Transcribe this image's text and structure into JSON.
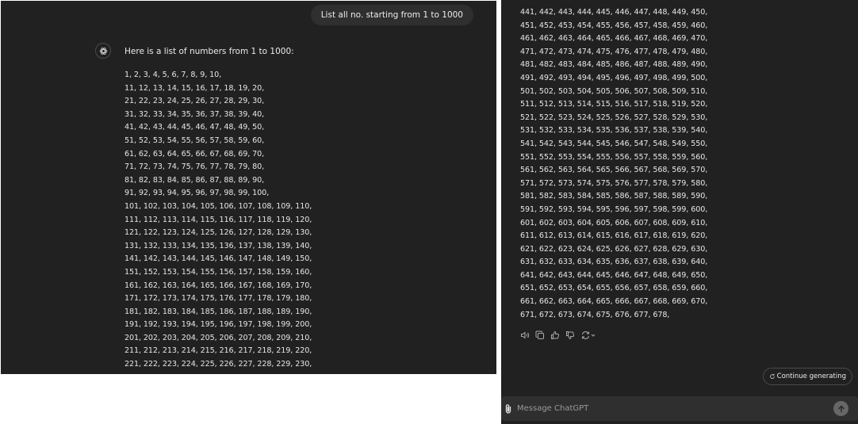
{
  "left": {
    "user_message": "List all no. starting from 1 to 1000",
    "intro": "Here is a list of numbers from 1 to 1000:",
    "lines": [
      "1, 2, 3, 4, 5, 6, 7, 8, 9, 10,",
      "11, 12, 13, 14, 15, 16, 17, 18, 19, 20,",
      "21, 22, 23, 24, 25, 26, 27, 28, 29, 30,",
      "31, 32, 33, 34, 35, 36, 37, 38, 39, 40,",
      "41, 42, 43, 44, 45, 46, 47, 48, 49, 50,",
      "51, 52, 53, 54, 55, 56, 57, 58, 59, 60,",
      "61, 62, 63, 64, 65, 66, 67, 68, 69, 70,",
      "71, 72, 73, 74, 75, 76, 77, 78, 79, 80,",
      "81, 82, 83, 84, 85, 86, 87, 88, 89, 90,",
      "91, 92, 93, 94, 95, 96, 97, 98, 99, 100,",
      "101, 102, 103, 104, 105, 106, 107, 108, 109, 110,",
      "111, 112, 113, 114, 115, 116, 117, 118, 119, 120,",
      "121, 122, 123, 124, 125, 126, 127, 128, 129, 130,",
      "131, 132, 133, 134, 135, 136, 137, 138, 139, 140,",
      "141, 142, 143, 144, 145, 146, 147, 148, 149, 150,",
      "151, 152, 153, 154, 155, 156, 157, 158, 159, 160,",
      "161, 162, 163, 164, 165, 166, 167, 168, 169, 170,",
      "171, 172, 173, 174, 175, 176, 177, 178, 179, 180,",
      "181, 182, 183, 184, 185, 186, 187, 188, 189, 190,",
      "191, 192, 193, 194, 195, 196, 197, 198, 199, 200,",
      "201, 202, 203, 204, 205, 206, 207, 208, 209, 210,",
      "211, 212, 213, 214, 215, 216, 217, 218, 219, 220,",
      "221, 222, 223, 224, 225, 226, 227, 228, 229, 230,"
    ]
  },
  "right": {
    "lines": [
      "441, 442, 443, 444, 445, 446, 447, 448, 449, 450,",
      "451, 452, 453, 454, 455, 456, 457, 458, 459, 460,",
      "461, 462, 463, 464, 465, 466, 467, 468, 469, 470,",
      "471, 472, 473, 474, 475, 476, 477, 478, 479, 480,",
      "481, 482, 483, 484, 485, 486, 487, 488, 489, 490,",
      "491, 492, 493, 494, 495, 496, 497, 498, 499, 500,",
      "501, 502, 503, 504, 505, 506, 507, 508, 509, 510,",
      "511, 512, 513, 514, 515, 516, 517, 518, 519, 520,",
      "521, 522, 523, 524, 525, 526, 527, 528, 529, 530,",
      "531, 532, 533, 534, 535, 536, 537, 538, 539, 540,",
      "541, 542, 543, 544, 545, 546, 547, 548, 549, 550,",
      "551, 552, 553, 554, 555, 556, 557, 558, 559, 560,",
      "561, 562, 563, 564, 565, 566, 567, 568, 569, 570,",
      "571, 572, 573, 574, 575, 576, 577, 578, 579, 580,",
      "581, 582, 583, 584, 585, 586, 587, 588, 589, 590,",
      "591, 592, 593, 594, 595, 596, 597, 598, 599, 600,",
      "601, 602, 603, 604, 605, 606, 607, 608, 609, 610,",
      "611, 612, 613, 614, 615, 616, 617, 618, 619, 620,",
      "621, 622, 623, 624, 625, 626, 627, 628, 629, 630,",
      "631, 632, 633, 634, 635, 636, 637, 638, 639, 640,",
      "641, 642, 643, 644, 645, 646, 647, 648, 649, 650,",
      "651, 652, 653, 654, 655, 656, 657, 658, 659, 660,",
      "661, 662, 663, 664, 665, 666, 667, 668, 669, 670,",
      "671, 672, 673, 674, 675, 676, 677, 678,"
    ],
    "action_icons": [
      "speaker-icon",
      "copy-icon",
      "thumbs-up-icon",
      "thumbs-down-icon",
      "regenerate-icon"
    ],
    "continue_label": "Continue generating",
    "composer": {
      "placeholder": "Message ChatGPT"
    }
  },
  "colors": {
    "background": "#212121",
    "bubble": "#2f2f2f",
    "text": "#ececec",
    "muted": "#9a9a9a",
    "send_button": "#676767"
  }
}
